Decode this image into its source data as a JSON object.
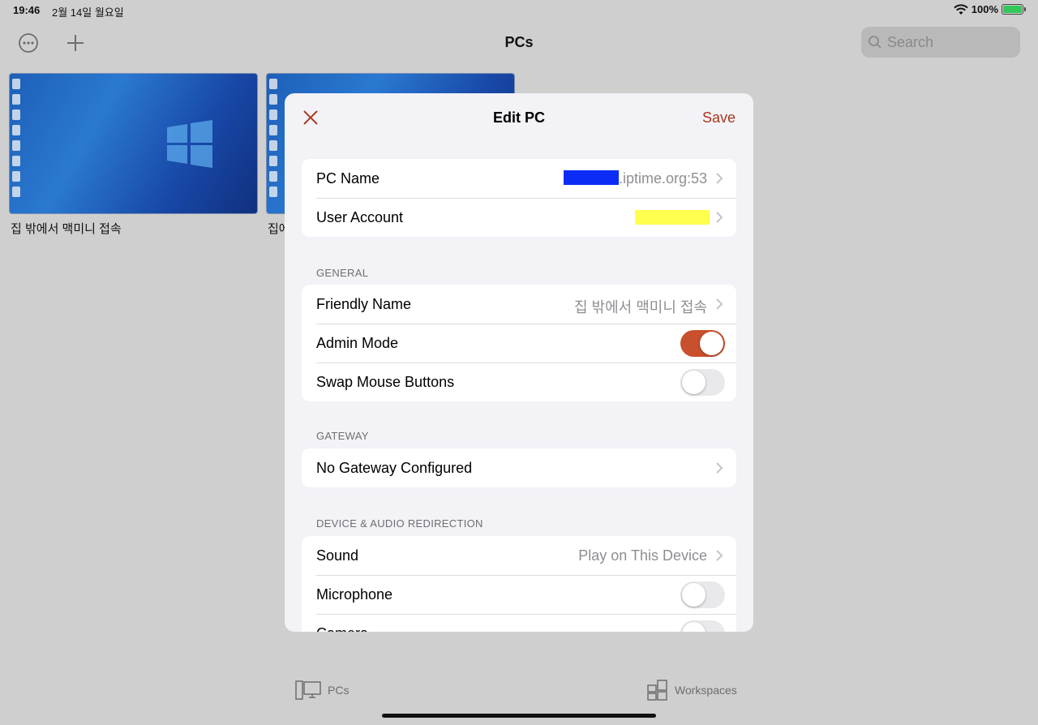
{
  "status_bar": {
    "time": "19:46",
    "date": "2월 14일 월요일",
    "battery": "100%"
  },
  "nav": {
    "title": "PCs",
    "search_placeholder": "Search"
  },
  "pc_tiles": [
    {
      "label": "집 밖에서 맥미니 접속"
    },
    {
      "label": "집에"
    }
  ],
  "modal": {
    "title": "Edit PC",
    "save_label": "Save",
    "rows_top": {
      "pc_name": {
        "label": "PC Name",
        "value": ".iptime.org:53"
      },
      "user_account": {
        "label": "User Account",
        "value": ""
      }
    },
    "general": {
      "header": "GENERAL",
      "friendly_name": {
        "label": "Friendly Name",
        "value": "집 밖에서 맥미니 접속"
      },
      "admin_mode": {
        "label": "Admin Mode",
        "on": true
      },
      "swap_mouse": {
        "label": "Swap Mouse Buttons",
        "on": false
      }
    },
    "gateway": {
      "header": "GATEWAY",
      "gateway_row": {
        "label": "No Gateway Configured"
      }
    },
    "device_audio": {
      "header": "DEVICE & AUDIO REDIRECTION",
      "sound": {
        "label": "Sound",
        "value": "Play on This Device"
      },
      "microphone": {
        "label": "Microphone",
        "on": false
      },
      "camera": {
        "label": "Camera",
        "on": false
      }
    }
  },
  "tabbar": {
    "pcs_label": "PCs",
    "workspaces_label": "Workspaces"
  },
  "colors": {
    "accent": "#c9502c",
    "save_text": "#a8391c"
  }
}
